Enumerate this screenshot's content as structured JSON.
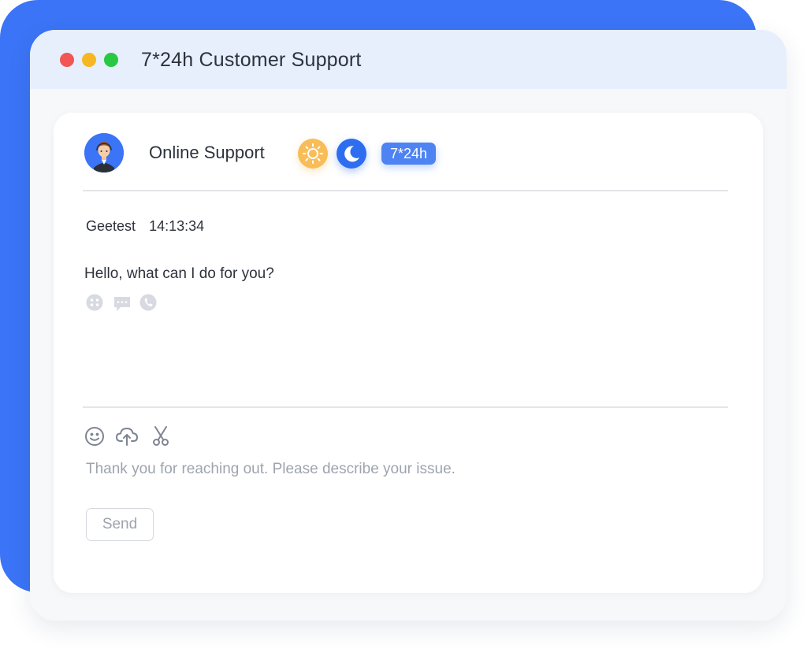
{
  "window": {
    "title": "7*24h Customer Support"
  },
  "agent": {
    "name": "Online Support",
    "hours_badge": "7*24h"
  },
  "message": {
    "sender": "Geetest",
    "time": "14:13:34",
    "text": "Hello, what can I do for you?",
    "reactions": [
      "like-icon",
      "comment-icon",
      "phone-icon"
    ]
  },
  "composer": {
    "tools": [
      "emoji-icon",
      "upload-cloud-icon",
      "scissors-icon"
    ],
    "placeholder": "Thank you for reaching out. Please describe your issue.",
    "send_label": "Send"
  },
  "colors": {
    "brand_blue": "#3b74f6",
    "sun_yellow": "#f8bd57",
    "moon_blue": "#2f6df0",
    "titlebar_bg": "#e7effd"
  }
}
